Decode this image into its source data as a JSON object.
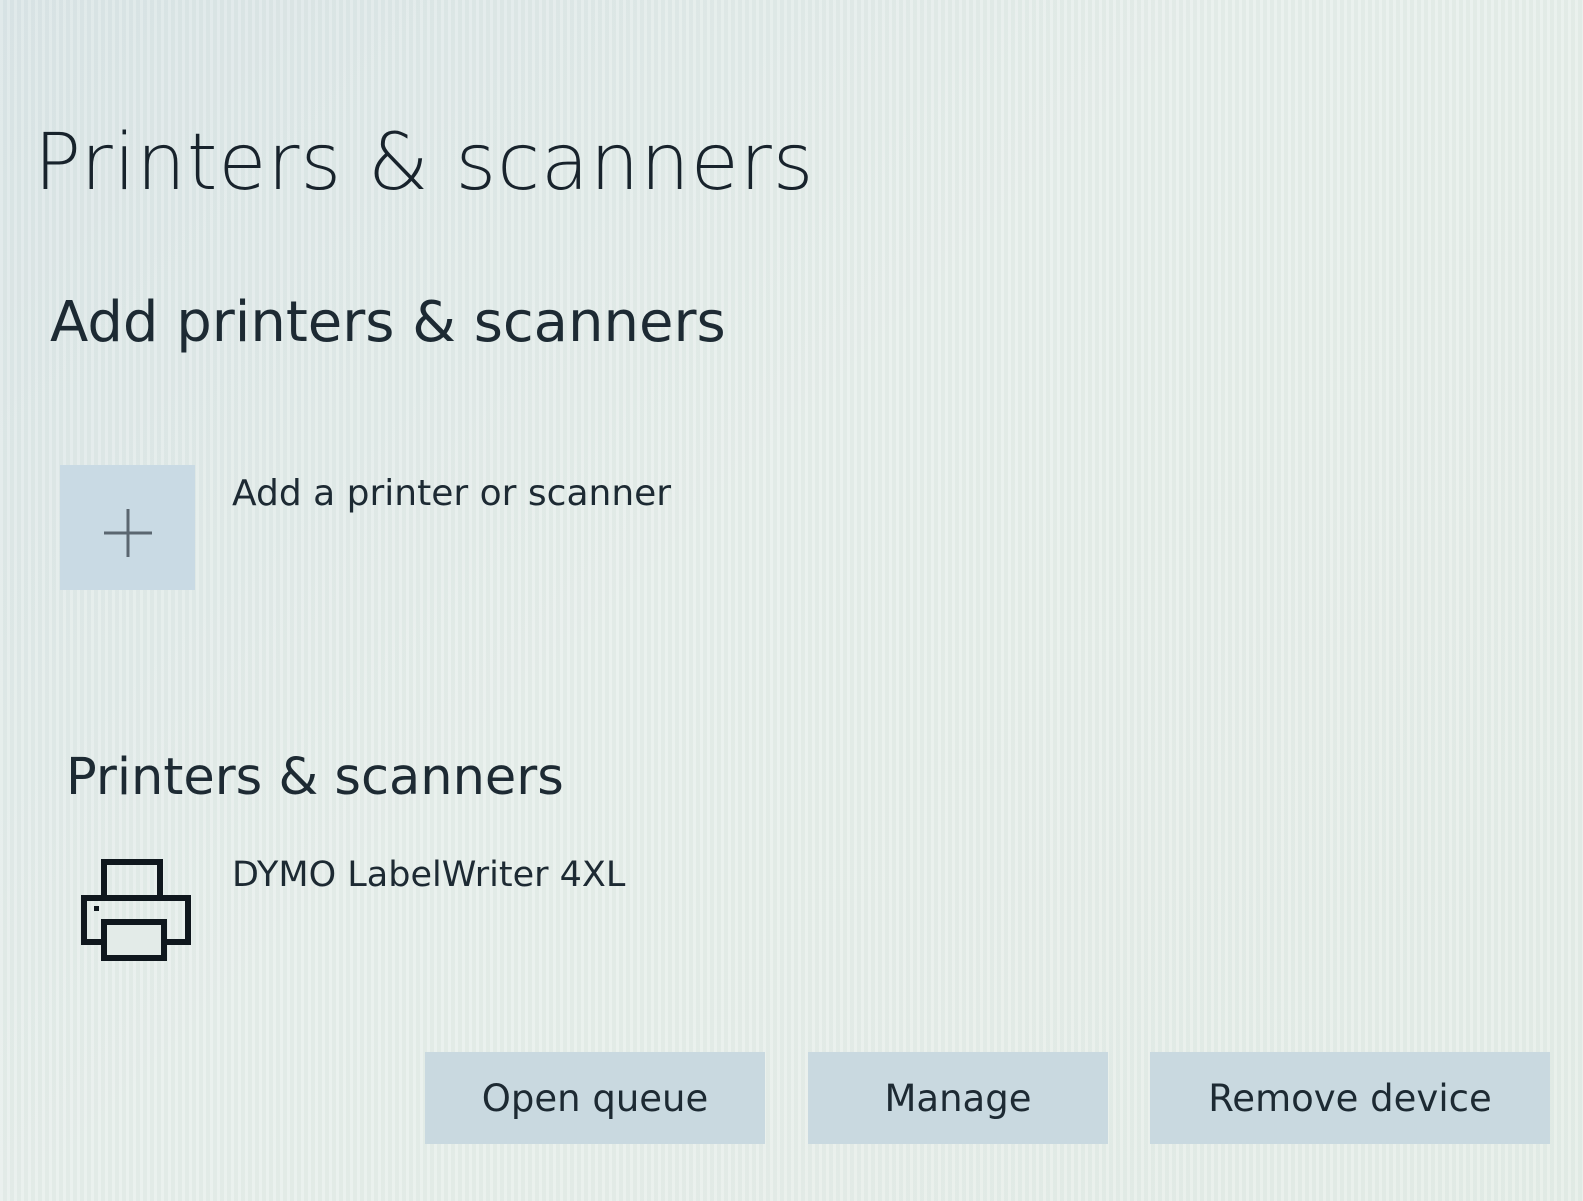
{
  "page": {
    "title": "Printers & scanners"
  },
  "add_section": {
    "heading": "Add printers & scanners",
    "add_button_label": "Add a printer or scanner",
    "add_icon": "plus-icon"
  },
  "devices_section": {
    "heading": "Printers & scanners",
    "devices": [
      {
        "name": "DYMO LabelWriter 4XL",
        "icon": "printer-icon"
      }
    ]
  },
  "device_actions": {
    "open_queue_label": "Open queue",
    "manage_label": "Manage",
    "remove_label": "Remove device"
  },
  "colors": {
    "background": "#e3ebe8",
    "tile": "#c9dae4",
    "button": "#c9d9e0",
    "text": "#1d2a33"
  }
}
